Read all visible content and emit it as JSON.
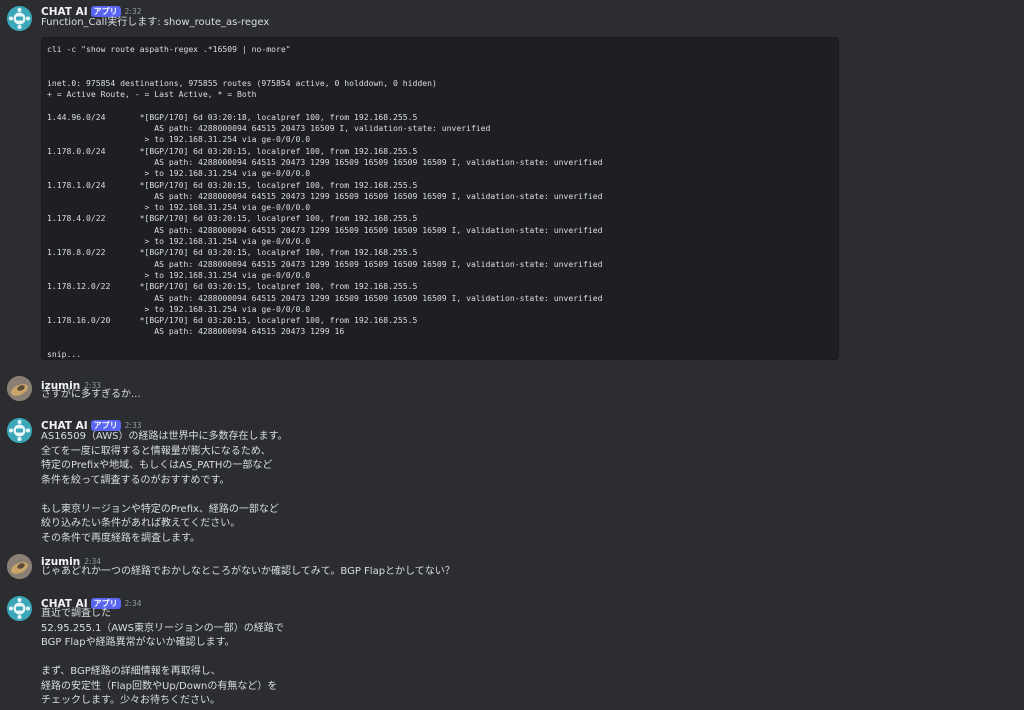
{
  "messages": [
    {
      "author": "CHAT AI",
      "badge": "アプリ",
      "time": "2:32",
      "text": "Function_Call実行します: show_route_as-regex",
      "code": "cli -c \"show route aspath-regex .*16509 | no-more\"\n\n\ninet.0: 975854 destinations, 975855 routes (975854 active, 0 holddown, 0 hidden)\n+ = Active Route, - = Last Active, * = Both\n\n1.44.96.0/24       *[BGP/170] 6d 03:20:18, localpref 100, from 192.168.255.5\n                      AS path: 4288000094 64515 20473 16509 I, validation-state: unverified\n                    > to 192.168.31.254 via ge-0/0/0.0\n1.178.0.0/24       *[BGP/170] 6d 03:20:15, localpref 100, from 192.168.255.5\n                      AS path: 4288000094 64515 20473 1299 16509 16509 16509 16509 I, validation-state: unverified\n                    > to 192.168.31.254 via ge-0/0/0.0\n1.178.1.0/24       *[BGP/170] 6d 03:20:15, localpref 100, from 192.168.255.5\n                      AS path: 4288000094 64515 20473 1299 16509 16509 16509 16509 I, validation-state: unverified\n                    > to 192.168.31.254 via ge-0/0/0.0\n1.178.4.0/22       *[BGP/170] 6d 03:20:15, localpref 100, from 192.168.255.5\n                      AS path: 4288000094 64515 20473 1299 16509 16509 16509 16509 I, validation-state: unverified\n                    > to 192.168.31.254 via ge-0/0/0.0\n1.178.8.0/22       *[BGP/170] 6d 03:20:15, localpref 100, from 192.168.255.5\n                      AS path: 4288000094 64515 20473 1299 16509 16509 16509 16509 I, validation-state: unverified\n                    > to 192.168.31.254 via ge-0/0/0.0\n1.178.12.0/22      *[BGP/170] 6d 03:20:15, localpref 100, from 192.168.255.5\n                      AS path: 4288000094 64515 20473 1299 16509 16509 16509 16509 I, validation-state: unverified\n                    > to 192.168.31.254 via ge-0/0/0.0\n1.178.16.0/20      *[BGP/170] 6d 03:20:15, localpref 100, from 192.168.255.5\n                      AS path: 4288000094 64515 20473 1299 16\n\nsnip..."
    },
    {
      "author": "izumin",
      "time": "2:33",
      "text": "さすがに多すぎるか..."
    },
    {
      "author": "CHAT AI",
      "badge": "アプリ",
      "time": "2:33",
      "text": "AS16509（AWS）の経路は世界中に多数存在します。\n全てを一度に取得すると情報量が膨大になるため、\n特定のPrefixや地域、もしくはAS_PATHの一部など\n条件を絞って調査するのがおすすめです。\n\nもし東京リージョンや特定のPrefix、経路の一部など\n絞り込みたい条件があれば教えてください。\nその条件で再度経路を調査します。"
    },
    {
      "author": "izumin",
      "time": "2:34",
      "text": "じゃあどれか一つの経路でおかしなところがないか確認してみて。BGP Flapとかしてない？"
    },
    {
      "author": "CHAT AI",
      "badge": "アプリ",
      "time": "2:34",
      "text": "直近で調査した\n52.95.255.1（AWS東京リージョンの一部）の経路で\nBGP Flapや経路異常がないか確認します。\n\nまず、BGP経路の詳細情報を再取得し、\n経路の安定性（Flap回数やUp/Downの有無など）を\nチェックします。少々お待ちください。"
    }
  ],
  "colors": {
    "background": "#2b2d31",
    "code_background": "#1e1f22",
    "badge": "#5865f2",
    "bot_avatar": "#3ba7b8"
  }
}
